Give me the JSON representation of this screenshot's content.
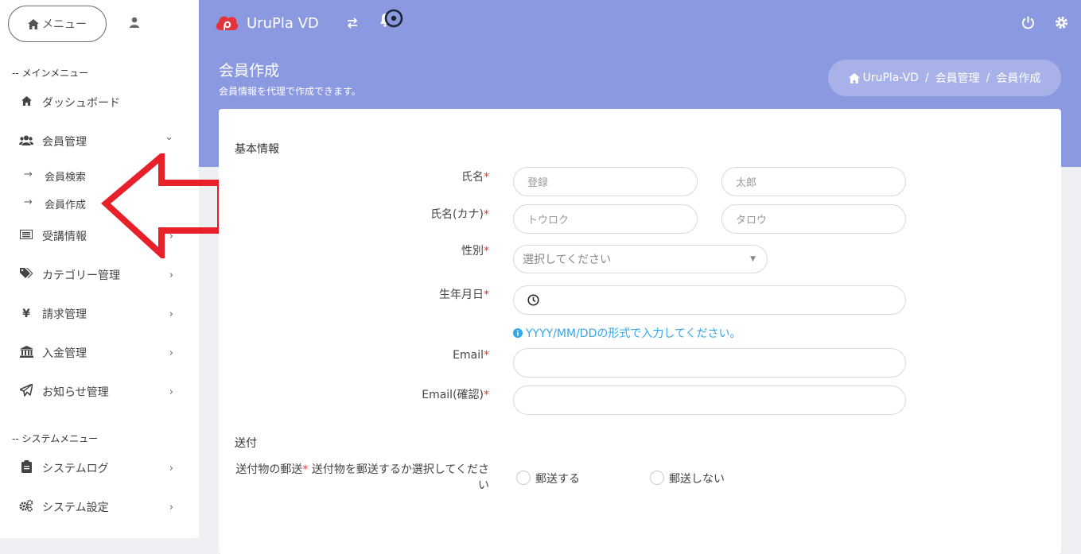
{
  "sidebar": {
    "menu_label": "メニュー",
    "main_menu_label": "-- メインメニュー",
    "system_menu_label": "-- システムメニュー",
    "items": [
      {
        "label": "ダッシュボード"
      },
      {
        "label": "会員管理"
      },
      {
        "label": "受講情報"
      },
      {
        "label": "カテゴリー管理"
      },
      {
        "label": "請求管理"
      },
      {
        "label": "入金管理"
      },
      {
        "label": "お知らせ管理"
      },
      {
        "label": "システムログ"
      },
      {
        "label": "システム設定"
      }
    ],
    "sub_items": [
      {
        "label": "会員検索"
      },
      {
        "label": "会員作成"
      }
    ],
    "sub_dash": "→",
    "yen_symbol": "¥",
    "chev_right": "›",
    "chev_down": "⌄"
  },
  "header": {
    "brand": "UruPla VD",
    "page_title": "会員作成",
    "page_subtitle": "会員情報を代理で作成できます。",
    "breadcrumb": [
      "UruPla-VD",
      "会員管理",
      "会員作成"
    ],
    "breadcrumb_sep": "/"
  },
  "form": {
    "basic_info_title": "基本情報",
    "name_label": "氏名",
    "kana_label": "氏名(カナ)",
    "gender_label": "性別",
    "birth_label": "生年月日",
    "email_label": "Email",
    "email_confirm_label": "Email(確認)",
    "required_mark": "*",
    "last_name_placeholder": "登録",
    "first_name_placeholder": "太郎",
    "last_kana_placeholder": "トウロク",
    "first_kana_placeholder": "タロウ",
    "gender_placeholder": "選択してください",
    "birth_help": "YYYY/MM/DDの形式で入力してください。",
    "shipping_title": "送付",
    "shipping_label_1": "送付物の郵送",
    "shipping_label_2": "送付物を郵送するか選択してくださ",
    "shipping_label_3": "い",
    "radio_yes": "郵送する",
    "radio_no": "郵送しない"
  },
  "colors": {
    "header_bg": "#8b99e0",
    "arrow": "#e8202a",
    "required": "#ee3333",
    "help": "#35a6e8"
  },
  "icons": [
    "home-icon",
    "user-icon",
    "logo-icon",
    "swap-icon",
    "bell-icon",
    "power-icon",
    "gear-icon",
    "users-icon",
    "list-icon",
    "tag-icon",
    "yen-icon",
    "bank-icon",
    "send-icon",
    "clipboard-icon",
    "cogs-icon",
    "clock-icon",
    "info-icon"
  ]
}
